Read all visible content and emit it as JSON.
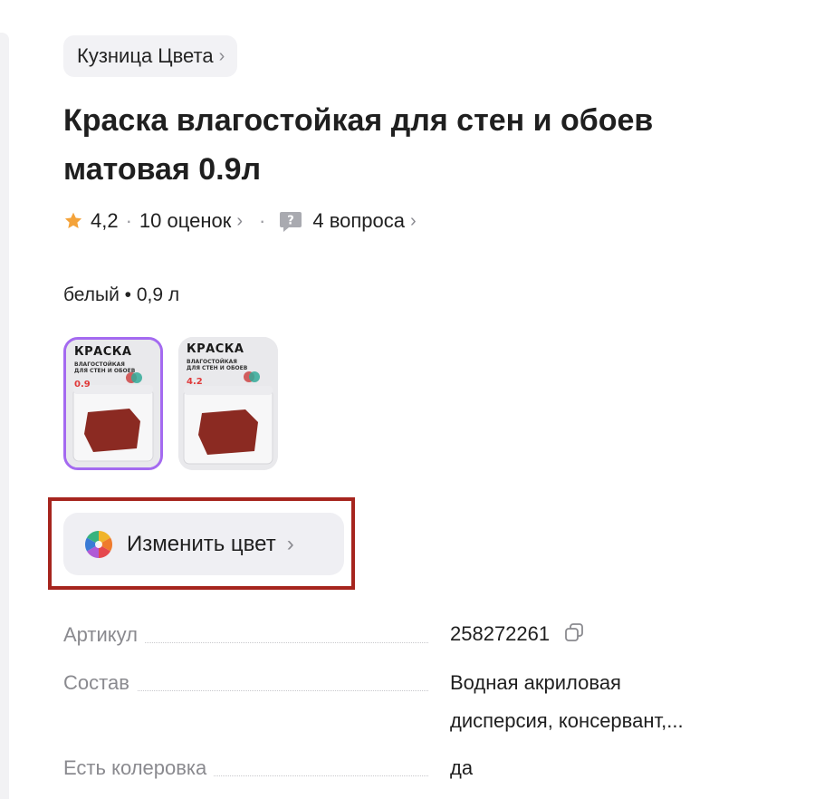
{
  "brand": {
    "label": "Кузница Цвета",
    "chevron": "›"
  },
  "product": {
    "title": "Краска влагостойкая для стен и обоев матовая 0.9л"
  },
  "rating": {
    "value": "4,2",
    "reviews_label": "10 оценок",
    "questions_label": "4 вопроса",
    "separator": "·",
    "chevron": "›",
    "star_color": "#f4a33a"
  },
  "variant": {
    "selected_label": "белый • 0,9 л"
  },
  "thumbnails": [
    {
      "title": "КРАСКА",
      "subtitle": "ВЛАГОСТОЙКАЯ ДЛЯ СТЕН И ОБОЕВ",
      "volume": "0.9",
      "selected": true
    },
    {
      "title": "КРАСКА",
      "subtitle": "ВЛАГОСТОЙКАЯ ДЛЯ СТЕН И ОБОЕВ",
      "volume": "4.2",
      "selected": false
    }
  ],
  "change_color": {
    "label": "Изменить цвет",
    "chevron": "›",
    "icon": "color-wheel-icon"
  },
  "specs": [
    {
      "key": "Артикул",
      "value": "258272261",
      "copy_icon": "copy-icon"
    },
    {
      "key": "Состав",
      "value_line1": "Водная акриловая",
      "value_line2": "дисперсия, консервант,..."
    },
    {
      "key": "Есть колеровка",
      "value": "да"
    }
  ],
  "colors": {
    "accent_selected": "#a46af0",
    "highlight_box": "#a6251e",
    "muted_text": "#8a8a8f"
  }
}
